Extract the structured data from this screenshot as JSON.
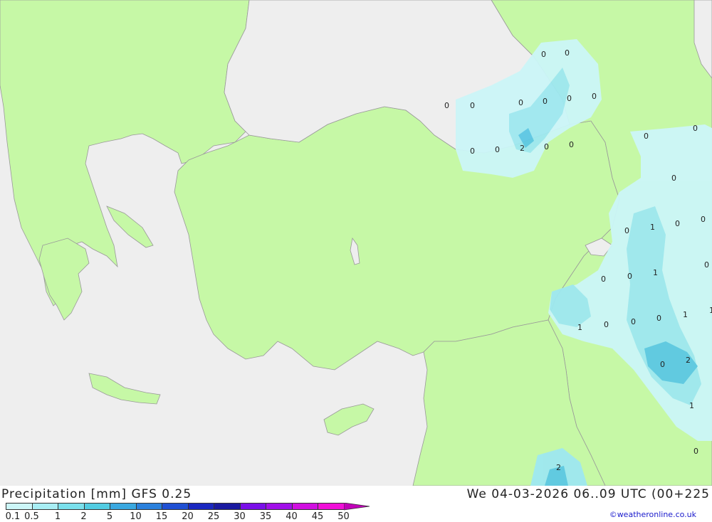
{
  "map": {
    "colors": {
      "sea": "#eeeeee",
      "land": "#c6f8a6",
      "border": "#999999",
      "precip_light": "#ccf6f8",
      "precip_medium": "#9ee8f0",
      "precip_heavy": "#5cc8e4"
    },
    "labels": [
      "0",
      "0",
      "0",
      "0",
      "0",
      "0",
      "0",
      "0",
      "0",
      "0",
      "0",
      "0",
      "2",
      "0",
      "0",
      "0",
      "0",
      "0",
      "0",
      "1",
      "0",
      "0",
      "0",
      "1",
      "1",
      "0",
      "0",
      "0",
      "1",
      "1",
      "0",
      "2",
      "2",
      "1",
      "0",
      "2",
      "1",
      "0"
    ]
  },
  "footer": {
    "title_left": "Precipitation [mm] GFS 0.25",
    "title_right": "We 04-03-2026 06..09 UTC (00+225",
    "credit": "©weatheronline.co.uk"
  },
  "legend": {
    "values": [
      "0.1",
      "0.5",
      "1",
      "2",
      "5",
      "10",
      "15",
      "20",
      "25",
      "30",
      "35",
      "40",
      "45",
      "50"
    ],
    "colors": [
      "#ccf6f8",
      "#a8eef4",
      "#7ae0ec",
      "#52cce2",
      "#3aa8e0",
      "#2a80dc",
      "#2050d4",
      "#1a28c0",
      "#1a1aa0",
      "#7a10e8",
      "#a010e8",
      "#d010e0",
      "#f010d8",
      "#c000b8"
    ]
  }
}
